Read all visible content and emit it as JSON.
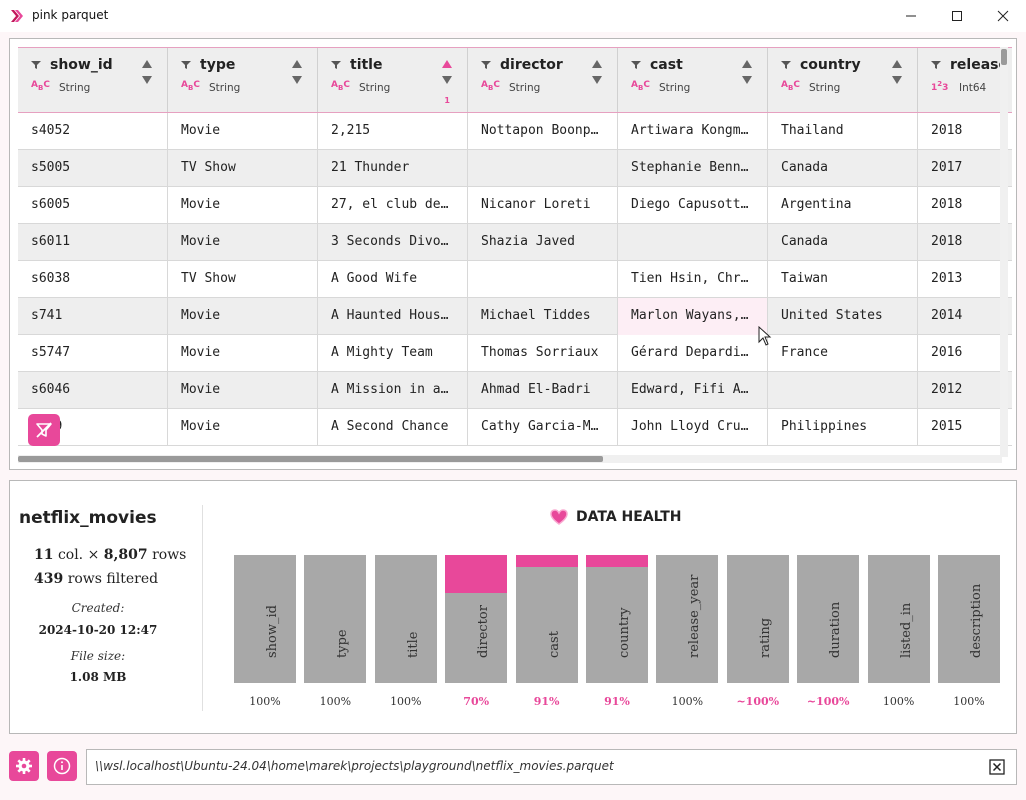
{
  "window": {
    "title": "pink parquet",
    "controls": [
      "minimize-icon",
      "maximize-icon",
      "close-icon"
    ]
  },
  "colors": {
    "accent": "#e8489a",
    "bar_gray": "#a8a8a8"
  },
  "table": {
    "columns": [
      {
        "name": "show_id",
        "type": "String",
        "type_icon": "abc-icon"
      },
      {
        "name": "type",
        "type": "String",
        "type_icon": "abc-icon"
      },
      {
        "name": "title",
        "type": "String",
        "type_icon": "abc-icon",
        "sorted": "asc",
        "sort_index": "1"
      },
      {
        "name": "director",
        "type": "String",
        "type_icon": "abc-icon"
      },
      {
        "name": "cast",
        "type": "String",
        "type_icon": "abc-icon"
      },
      {
        "name": "country",
        "type": "String",
        "type_icon": "abc-icon"
      },
      {
        "name": "release",
        "type": "Int64",
        "type_icon": "123-icon"
      }
    ],
    "rows": [
      [
        "s4052",
        "Movie",
        "2,215",
        "Nottapon Boonp…",
        "Artiwara Kongm…",
        "Thailand",
        "2018"
      ],
      [
        "s5005",
        "TV Show",
        "21 Thunder",
        "",
        "Stephanie Benn…",
        "Canada",
        "2017"
      ],
      [
        "s6005",
        "Movie",
        "27, el club de…",
        "Nicanor Loreti",
        "Diego Capusott…",
        "Argentina",
        "2018"
      ],
      [
        "s6011",
        "Movie",
        "3 Seconds Divo…",
        "Shazia Javed",
        "",
        "Canada",
        "2018"
      ],
      [
        "s6038",
        "TV Show",
        "A Good Wife",
        "",
        "Tien Hsin, Chr…",
        "Taiwan",
        "2013"
      ],
      [
        "s741",
        "Movie",
        "A Haunted Hous…",
        "Michael Tiddes",
        "Marlon Wayans,…",
        "United States",
        "2014"
      ],
      [
        "s5747",
        "Movie",
        "A Mighty Team",
        "Thomas Sorriaux",
        "Gérard Depardi…",
        "France",
        "2016"
      ],
      [
        "s6046",
        "Movie",
        "A Mission in a…",
        "Ahmad El-Badri",
        "Edward, Fifi A…",
        "",
        "2012"
      ],
      [
        "s__9",
        "Movie",
        "A Second Chance",
        "Cathy Garcia-M…",
        "John Lloyd Cru…",
        "Philippines",
        "2015"
      ]
    ]
  },
  "dataset": {
    "name": "netflix_movies",
    "col_count": "11",
    "col_label": "col. ×",
    "row_count": "8,807",
    "row_label": "rows",
    "filtered_count": "439",
    "filtered_label": "rows filtered",
    "created_label": "Created:",
    "created_value": "2024-10-20 12:47",
    "size_label": "File size:",
    "size_value": "1.08 MB"
  },
  "data_health": {
    "title": "DATA HEALTH",
    "icon": "heart-icon",
    "columns": [
      {
        "name": "show_id",
        "completeness": 1.0,
        "label": "100%",
        "highlight": false
      },
      {
        "name": "type",
        "completeness": 1.0,
        "label": "100%",
        "highlight": false
      },
      {
        "name": "title",
        "completeness": 1.0,
        "label": "100%",
        "highlight": false
      },
      {
        "name": "director",
        "completeness": 0.7,
        "label": "70%",
        "highlight": true
      },
      {
        "name": "cast",
        "completeness": 0.91,
        "label": "91%",
        "highlight": true
      },
      {
        "name": "country",
        "completeness": 0.91,
        "label": "91%",
        "highlight": true
      },
      {
        "name": "release_year",
        "completeness": 1.0,
        "label": "100%",
        "highlight": false
      },
      {
        "name": "rating",
        "completeness": 1.0,
        "label": "~100%",
        "highlight": true
      },
      {
        "name": "duration",
        "completeness": 1.0,
        "label": "~100%",
        "highlight": true
      },
      {
        "name": "listed_in",
        "completeness": 1.0,
        "label": "100%",
        "highlight": false
      },
      {
        "name": "description",
        "completeness": 1.0,
        "label": "100%",
        "highlight": false
      }
    ]
  },
  "footer": {
    "settings_icon": "gear-icon",
    "info_icon": "info-icon",
    "file_path": "\\\\wsl.localhost\\Ubuntu-24.04\\home\\marek\\projects\\playground\\netflix_movies.parquet",
    "clear_icon": "close-box-icon"
  }
}
